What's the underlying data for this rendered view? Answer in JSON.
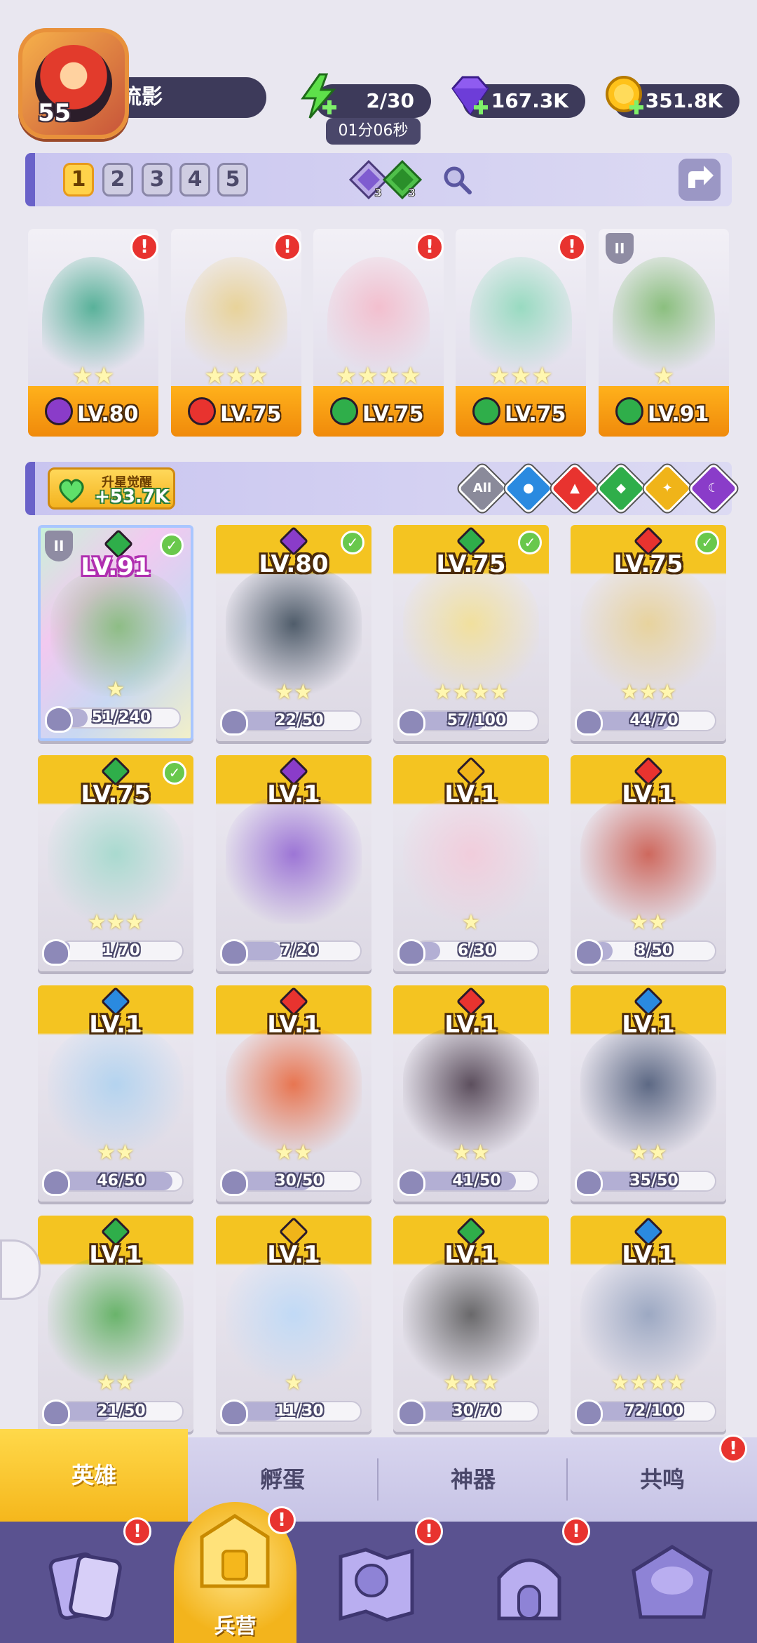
{
  "player": {
    "level": "55",
    "name": "流影"
  },
  "resources": {
    "energy": "2/30",
    "energy_timer": "01分06秒",
    "gems": "167.3K",
    "coins": "351.8K"
  },
  "team_tabs": [
    "1",
    "2",
    "3",
    "4",
    "5"
  ],
  "team_tab_active": "1",
  "team_badges": {
    "purple_count": "3",
    "green_count": "3"
  },
  "team": [
    {
      "level": "LV.80",
      "element": "dark",
      "stars": 2,
      "alert": true
    },
    {
      "level": "LV.75",
      "element": "fire",
      "stars": 3,
      "alert": true
    },
    {
      "level": "LV.75",
      "element": "nature",
      "stars": 4,
      "alert": true
    },
    {
      "level": "LV.75",
      "element": "nature",
      "stars": 3,
      "alert": true
    },
    {
      "level": "LV.91",
      "element": "nature",
      "stars": 1,
      "alert": false,
      "rank": "II"
    }
  ],
  "filter": {
    "awaken_label": "升星觉醒",
    "awaken_value": "+53.7K",
    "all_label": "All"
  },
  "heroes": [
    {
      "level": "LV.91",
      "element": "nature",
      "progress": "51/240",
      "fill": 0.21,
      "stars": 1,
      "check": true,
      "rank": "II",
      "rainbow": true
    },
    {
      "level": "LV.80",
      "element": "dark",
      "progress": "22/50",
      "fill": 0.44,
      "stars": 2,
      "check": true
    },
    {
      "level": "LV.75",
      "element": "nature",
      "progress": "57/100",
      "fill": 0.57,
      "stars": 4,
      "check": true
    },
    {
      "level": "LV.75",
      "element": "fire",
      "progress": "44/70",
      "fill": 0.63,
      "stars": 3,
      "check": true
    },
    {
      "level": "LV.75",
      "element": "nature",
      "progress": "1/70",
      "fill": 0.01,
      "stars": 3,
      "check": true
    },
    {
      "level": "LV.1",
      "element": "dark",
      "progress": "7/20",
      "fill": 0.35,
      "stars": 0,
      "check": false
    },
    {
      "level": "LV.1",
      "element": "light",
      "progress": "6/30",
      "fill": 0.2,
      "stars": 1,
      "check": false
    },
    {
      "level": "LV.1",
      "element": "fire",
      "progress": "8/50",
      "fill": 0.16,
      "stars": 2,
      "check": false
    },
    {
      "level": "LV.1",
      "element": "water",
      "progress": "46/50",
      "fill": 0.92,
      "stars": 2,
      "check": false
    },
    {
      "level": "LV.1",
      "element": "fire",
      "progress": "30/50",
      "fill": 0.6,
      "stars": 2,
      "check": false
    },
    {
      "level": "LV.1",
      "element": "fire",
      "progress": "41/50",
      "fill": 0.82,
      "stars": 2,
      "check": false
    },
    {
      "level": "LV.1",
      "element": "water",
      "progress": "35/50",
      "fill": 0.7,
      "stars": 2,
      "check": false
    },
    {
      "level": "LV.1",
      "element": "nature",
      "progress": "21/50",
      "fill": 0.42,
      "stars": 2,
      "check": false
    },
    {
      "level": "LV.1",
      "element": "light",
      "progress": "11/30",
      "fill": 0.37,
      "stars": 1,
      "check": false
    },
    {
      "level": "LV.1",
      "element": "nature",
      "progress": "30/70",
      "fill": 0.43,
      "stars": 3,
      "check": false
    },
    {
      "level": "LV.1",
      "element": "water",
      "progress": "72/100",
      "fill": 0.72,
      "stars": 4,
      "check": false
    }
  ],
  "subtabs": [
    "英雄",
    "孵蛋",
    "神器",
    "共鸣"
  ],
  "subtab_active": "英雄",
  "nav": {
    "active_label": "兵营"
  },
  "colors": {
    "dark": "#8a3cc9",
    "fire": "#e8332f",
    "nature": "#2fae4a",
    "water": "#2a8ae0",
    "light": "#f0b419"
  }
}
